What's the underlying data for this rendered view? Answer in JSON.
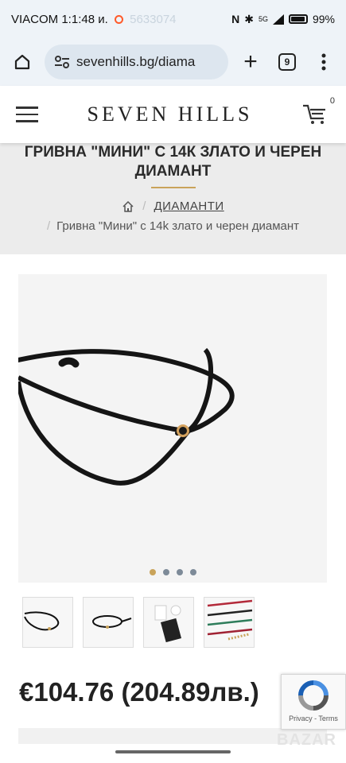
{
  "status_bar": {
    "carrier_time": "VIACOM 1:1:48 и.",
    "ghost_text": "5633074",
    "battery": "99%",
    "network": "5G"
  },
  "browser": {
    "url": "sevenhills.bg/diama",
    "tab_count": "9"
  },
  "site": {
    "logo": "SEVEN HILLS",
    "cart_count": "0"
  },
  "product": {
    "title": "ГРИВНА \"МИНИ\" С 14К ЗЛАТО И ЧЕРЕН ДИАМАНТ",
    "breadcrumb_category": "ДИАМАНТИ",
    "breadcrumb_current": "Гривна \"Мини\" с 14k злато и черен диамант",
    "price": "€104.76 (204.89лв.)",
    "gallery_slide_count": 4,
    "gallery_active_index": 0
  },
  "recaptcha": {
    "text": "Privacy - Terms"
  },
  "watermark": "BAZAR",
  "colors": {
    "accent_gold": "#c9a35a",
    "title_band": "#ececec",
    "browser_chrome": "#eef3f8"
  }
}
